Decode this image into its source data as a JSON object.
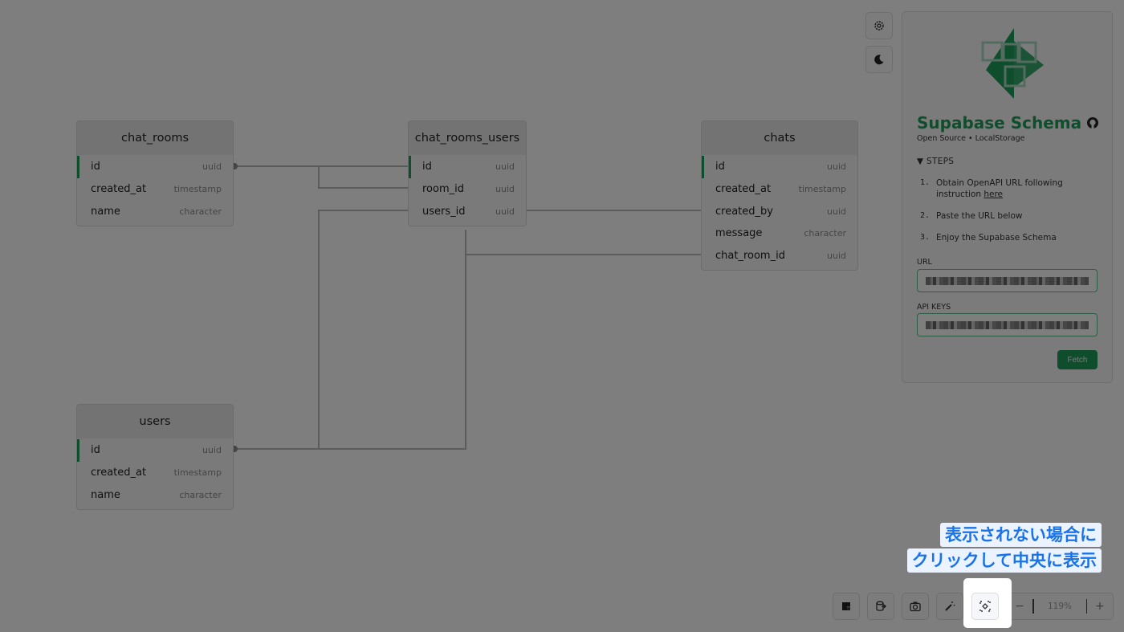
{
  "app": {
    "name": "Supabase Schema",
    "subtitle": "Open Source • LocalStorage",
    "accent_color": "#1f9d5b"
  },
  "tables": [
    {
      "name": "chat_rooms",
      "columns": [
        {
          "name": "id",
          "type": "uuid",
          "primary": true
        },
        {
          "name": "created_at",
          "type": "timestamp",
          "primary": false
        },
        {
          "name": "name",
          "type": "character",
          "primary": false
        }
      ]
    },
    {
      "name": "chat_rooms_users",
      "columns": [
        {
          "name": "id",
          "type": "uuid",
          "primary": true
        },
        {
          "name": "room_id",
          "type": "uuid",
          "primary": false
        },
        {
          "name": "users_id",
          "type": "uuid",
          "primary": false
        }
      ]
    },
    {
      "name": "chats",
      "columns": [
        {
          "name": "id",
          "type": "uuid",
          "primary": true
        },
        {
          "name": "created_at",
          "type": "timestamp",
          "primary": false
        },
        {
          "name": "created_by",
          "type": "uuid",
          "primary": false
        },
        {
          "name": "message",
          "type": "character",
          "primary": false
        },
        {
          "name": "chat_room_id",
          "type": "uuid",
          "primary": false
        }
      ]
    },
    {
      "name": "users",
      "columns": [
        {
          "name": "id",
          "type": "uuid",
          "primary": true
        },
        {
          "name": "created_at",
          "type": "timestamp",
          "primary": false
        },
        {
          "name": "name",
          "type": "character",
          "primary": false
        }
      ]
    }
  ],
  "relations": [
    {
      "from": "chat_rooms.id",
      "to": "chat_rooms_users.id"
    },
    {
      "from": "chat_rooms.id",
      "to": "chat_rooms_users.room_id"
    },
    {
      "from": "users.id",
      "to": "chat_rooms_users.users_id"
    },
    {
      "from": "users.id",
      "to": "chats.created_by"
    },
    {
      "from": "users.id",
      "to": "chats.chat_room_id"
    }
  ],
  "panel": {
    "steps_heading": "▼ STEPS",
    "steps": [
      {
        "num": "1.",
        "text": "Obtain OpenAPI URL following instruction ",
        "link": "here"
      },
      {
        "num": "2.",
        "text": "Paste the URL below",
        "link": ""
      },
      {
        "num": "3.",
        "text": "Enjoy the Supabase Schema",
        "link": ""
      }
    ],
    "url_label": "URL",
    "url_value": "(redacted)",
    "api_keys_label": "API KEYS",
    "api_keys_value": "(redacted)",
    "fetch_label": "Fetch"
  },
  "toolbar": {
    "buttons": [
      "typescript-export",
      "sql-export",
      "screenshot",
      "auto-arrange",
      "center-view"
    ],
    "zoom_out": "−",
    "zoom_level": "119%",
    "zoom_in": "+"
  },
  "annotation": {
    "line1": "表示されない場合に",
    "line2": "クリックして中央に表示"
  }
}
